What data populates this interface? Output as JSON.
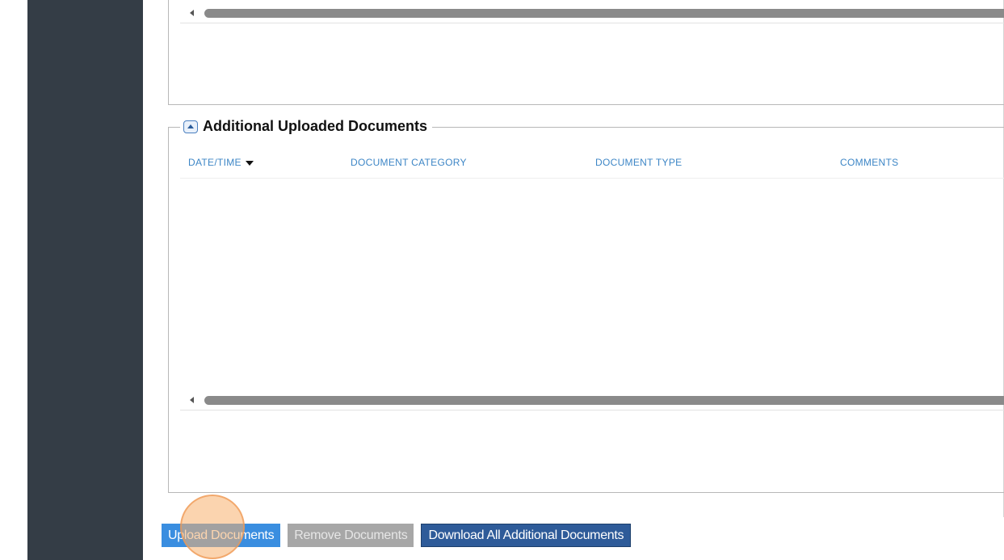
{
  "section": {
    "title": "Additional Uploaded Documents",
    "collapse_icon": "chevron-up-icon"
  },
  "grid": {
    "columns": [
      {
        "label": "DATE/TIME",
        "sorted": "desc"
      },
      {
        "label": "DOCUMENT CATEGORY"
      },
      {
        "label": "DOCUMENT TYPE"
      },
      {
        "label": "COMMENTS"
      }
    ],
    "rows": []
  },
  "buttons": {
    "upload": "Upload Documents",
    "remove": "Remove Documents",
    "download_all": "Download All Additional Documents"
  },
  "colors": {
    "sidebar": "#343d46",
    "header_link": "#3d86c6",
    "upload_button": "#3a8ee0",
    "remove_button_disabled": "#a7a7a7",
    "download_button": "#2e5b99"
  }
}
